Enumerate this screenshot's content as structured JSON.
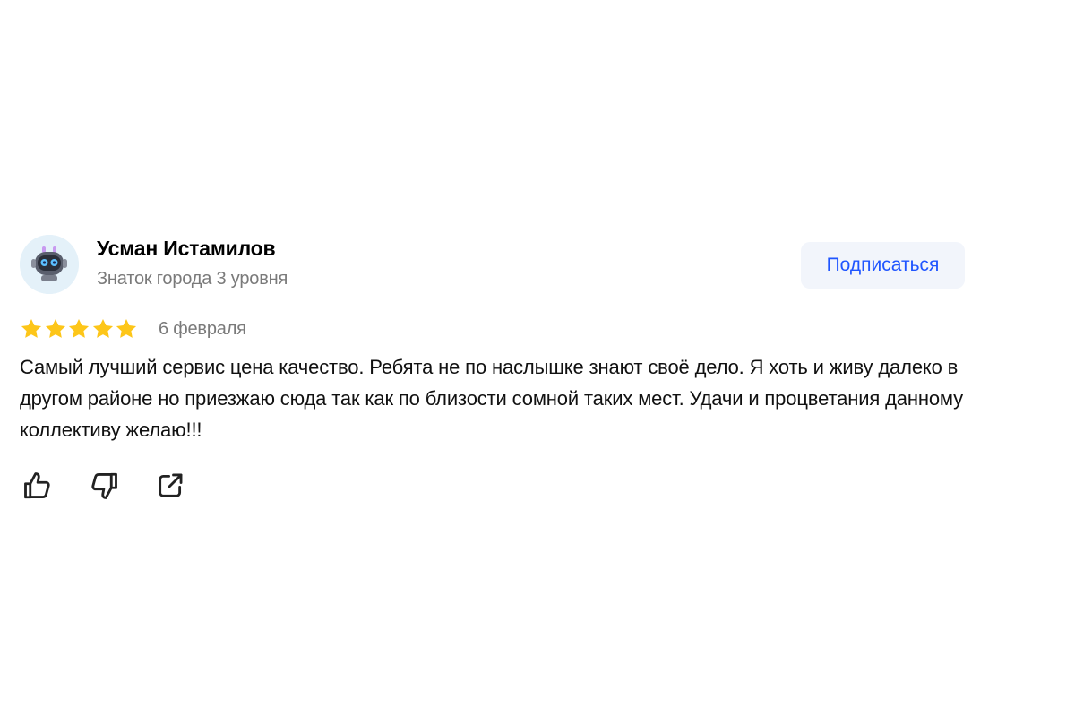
{
  "author": {
    "name": "Усман Истамилов",
    "level": "Знаток города 3 уровня"
  },
  "subscribe_label": "Подписаться",
  "rating": {
    "stars": 5,
    "max": 5
  },
  "date": "6 февраля",
  "text": "Самый лучший сервис цена качество. Ребята не по наслышке знают своё дело. Я хоть и живу далеко в другом районе но приезжаю сюда так как по близости сомной таких мест. Удачи и процветания данному коллективу желаю!!!",
  "actions": {
    "like_icon": "thumbs-up-icon",
    "dislike_icon": "thumbs-down-icon",
    "share_icon": "share-icon"
  },
  "colors": {
    "star": "#fdc619",
    "accent": "#1f55ff",
    "button_bg": "#f2f5fb",
    "avatar_bg": "#e4f1f9",
    "muted_text": "#7a7a7a"
  }
}
